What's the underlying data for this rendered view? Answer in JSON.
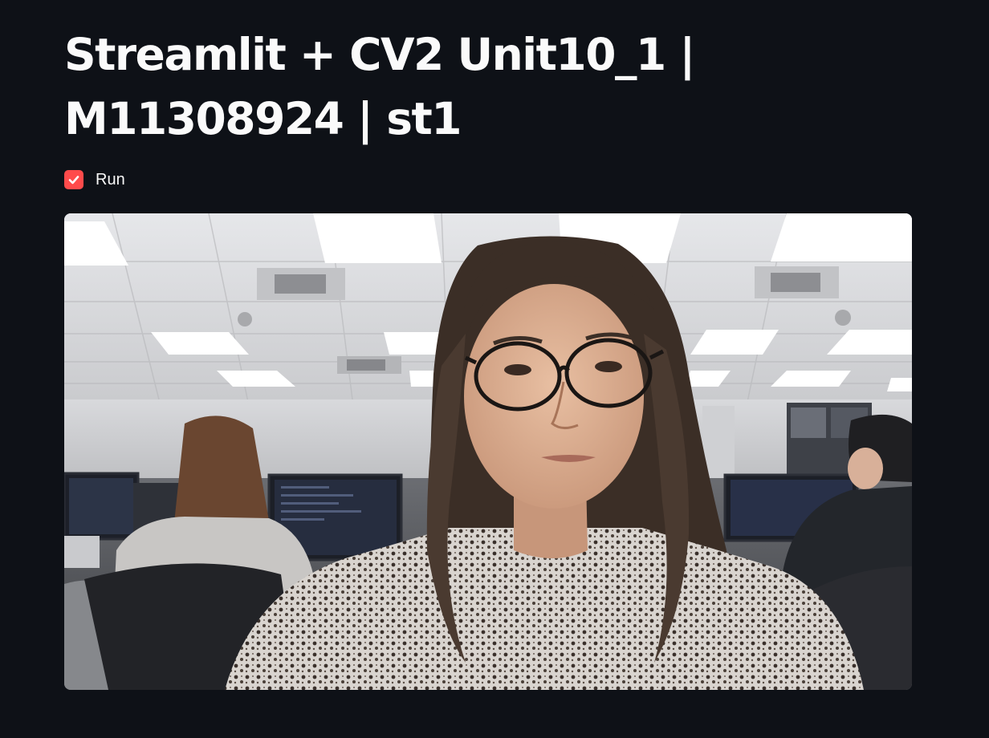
{
  "page": {
    "title": "Streamlit + CV2 Unit10_1 | M11308924 | st1"
  },
  "run_checkbox": {
    "label": "Run",
    "checked": true,
    "accent_color": "#ff4b4b"
  },
  "video_frame": {
    "content": "webcam-frame"
  },
  "colors": {
    "background": "#0e1117",
    "text": "#fafafa"
  }
}
